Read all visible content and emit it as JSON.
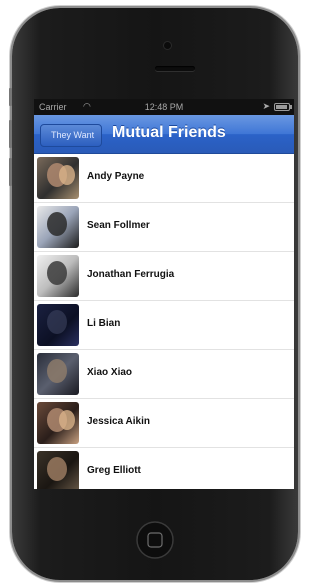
{
  "status_bar": {
    "carrier": "Carrier",
    "time": "12:48 PM",
    "battery_level": 0.9
  },
  "navbar": {
    "back_label": "They Want",
    "title": "Mutual Friends"
  },
  "friends": [
    {
      "name": "Andy Payne"
    },
    {
      "name": "Sean Follmer"
    },
    {
      "name": "Jonathan Ferrugia"
    },
    {
      "name": "Li Bian"
    },
    {
      "name": "Xiao Xiao"
    },
    {
      "name": "Jessica Aikin"
    },
    {
      "name": "Greg Elliott"
    }
  ],
  "colors": {
    "navbar_blue": "#3f76d6",
    "phone_body": "#151515"
  }
}
